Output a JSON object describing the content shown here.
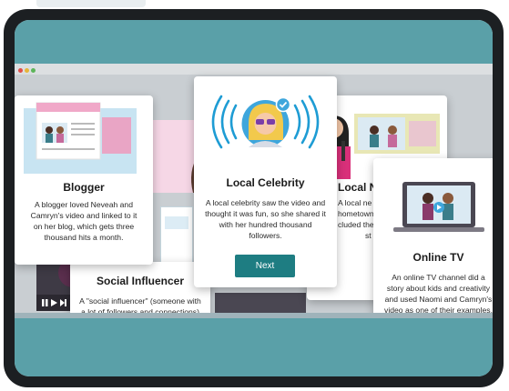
{
  "colors": {
    "teal": "#5aa0a8",
    "button": "#1e7d82",
    "badge": "#3ea6dc"
  },
  "cards": {
    "blogger": {
      "title": "Blogger",
      "body": "A blogger loved Neveah and Camryn's video and linked to it on her blog, which gets three thousand hits a month."
    },
    "social_influencer": {
      "title": "Social Influencer",
      "body": "A \"social influencer\" (someone with a lot of followers and connections) shared it on his social media."
    },
    "local_celebrity": {
      "title": "Local Celebrity",
      "body": "A local celebrity saw the video and thought it was fun, so she shared it with her hundred thousand followers.",
      "button_label": "Next"
    },
    "local_news": {
      "title": "Local N",
      "body_lines": [
        "A local ne",
        "hometown",
        "cluded the",
        "st"
      ]
    },
    "online_tv": {
      "title": "Online TV",
      "body": "An online TV channel did a story about kids and creativity and used Naomi and Camryn's video as one of their examples."
    }
  },
  "icons": [
    "play-icon",
    "pause-icon",
    "skip-icon",
    "checkmark-icon",
    "broadcast-waves-icon"
  ]
}
